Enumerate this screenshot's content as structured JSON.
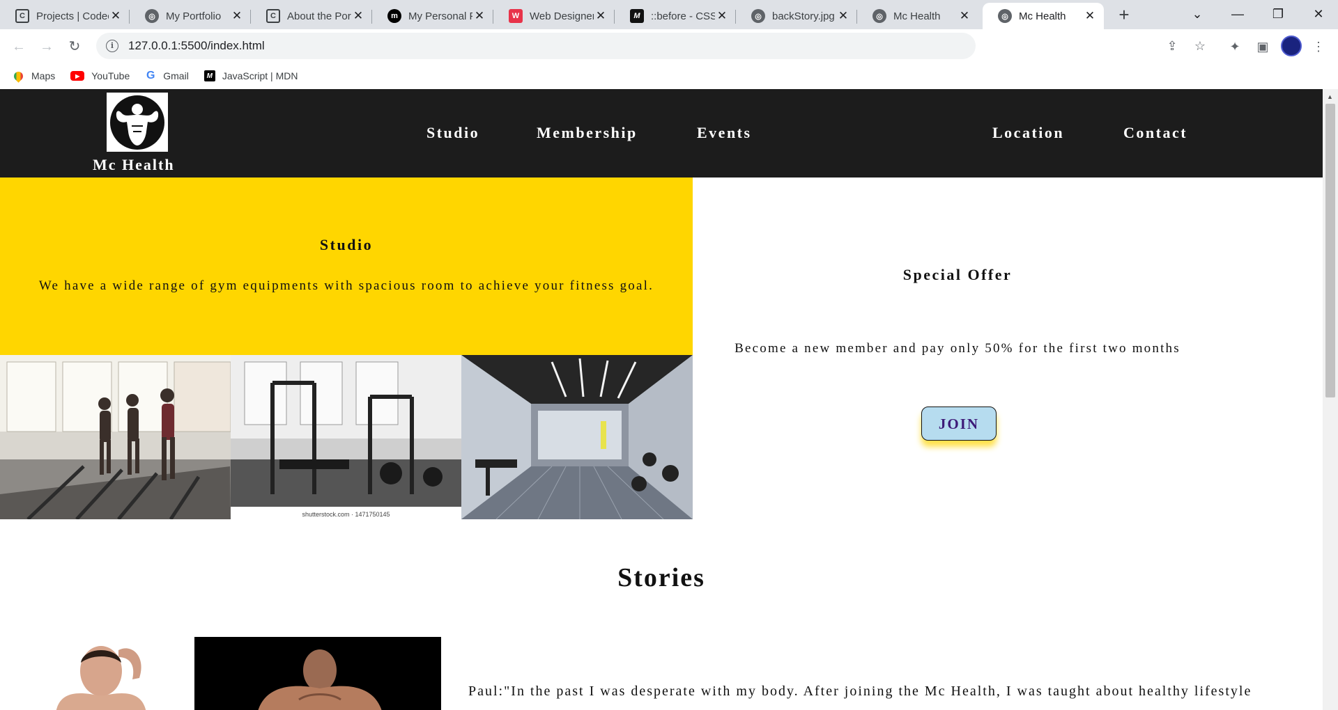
{
  "browser": {
    "tabs": [
      {
        "title": "Projects | Codecademy",
        "favicon": "codecademy-icon",
        "active": false
      },
      {
        "title": "My Portfolio",
        "favicon": "globe-icon",
        "active": false
      },
      {
        "title": "About the Portfolio",
        "favicon": "codecademy-icon",
        "active": false
      },
      {
        "title": "My Personal Portfolio",
        "favicon": "personal-site-icon",
        "active": false
      },
      {
        "title": "Web Designer",
        "favicon": "w-icon",
        "active": false
      },
      {
        "title": "::before - CSS",
        "favicon": "mdn-icon",
        "active": false
      },
      {
        "title": "backStory.jpg",
        "favicon": "globe-icon",
        "active": false
      },
      {
        "title": "Mc Health",
        "favicon": "globe-icon",
        "active": false
      },
      {
        "title": "Mc Health",
        "favicon": "globe-icon",
        "active": true
      }
    ],
    "url": "127.0.0.1:5500/index.html",
    "bookmarks": [
      {
        "label": "Maps",
        "icon": "maps-icon"
      },
      {
        "label": "YouTube",
        "icon": "youtube-icon"
      },
      {
        "label": "Gmail",
        "icon": "google-icon"
      },
      {
        "label": "JavaScript | MDN",
        "icon": "mdn-icon"
      }
    ]
  },
  "site": {
    "brand": "Mc Health",
    "nav": [
      "Studio",
      "Membership",
      "Events",
      "Location",
      "Contact"
    ],
    "studio": {
      "title": "Studio",
      "description": "We have a wide range of gym equipments with spacious room to achieve your fitness goal.",
      "watermark": "shutterstock.com · 1471750145"
    },
    "offer": {
      "title": "Special Offer",
      "text": "Become a new member and pay only 50% for the first two months",
      "button": "JOIN"
    },
    "stories": {
      "title": "Stories",
      "quote": "Paul:\"In the past I was desperate with my body. After joining the Mc Health, I was taught about healthy lifestyle"
    }
  },
  "colors": {
    "header_bg": "#1c1c1c",
    "studio_bg": "#ffd600",
    "join_bg": "#b6dcef",
    "join_text": "#3d1a78",
    "join_glow": "#ffe14a"
  }
}
